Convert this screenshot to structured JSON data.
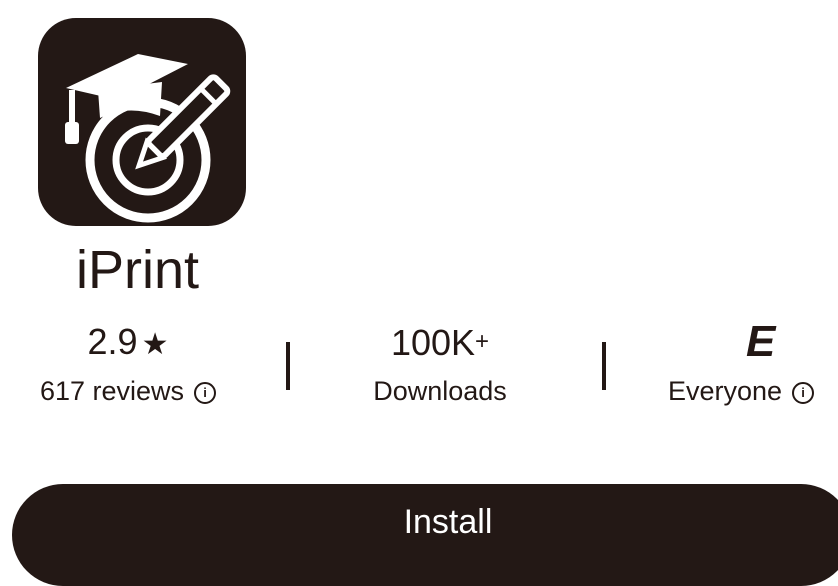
{
  "app": {
    "name": "iPrint",
    "icon": "graduation-cap-pen-icon"
  },
  "stats": {
    "rating": {
      "value": "2.9",
      "star": "★",
      "label": "617 reviews"
    },
    "downloads": {
      "value": "100K",
      "plus": "+",
      "label": "Downloads"
    },
    "content_rating": {
      "value": "E",
      "label": "Everyone"
    }
  },
  "install": {
    "label": "Install"
  },
  "colors": {
    "primary": "#231815",
    "background": "#ffffff"
  }
}
